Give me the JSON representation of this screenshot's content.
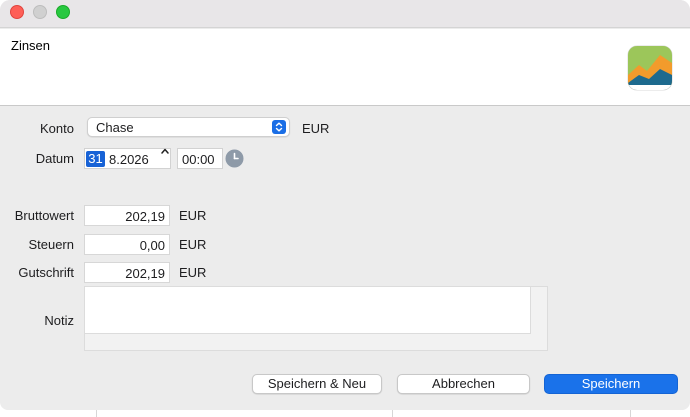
{
  "window": {
    "header_title": "Zinsen",
    "app_logo": "portfolio-chart-logo-icon"
  },
  "form": {
    "account_label": "Konto",
    "account_value": "Chase",
    "account_currency": "EUR",
    "date_label": "Datum",
    "date_day": "31",
    "date_rest": "8.2026",
    "time_value": "00:00",
    "gross_label": "Bruttowert",
    "gross_value": "202,19",
    "gross_currency": "EUR",
    "taxes_label": "Steuern",
    "taxes_value": "0,00",
    "taxes_currency": "EUR",
    "credit_label": "Gutschrift",
    "credit_value": "202,19",
    "credit_currency": "EUR",
    "note_label": "Notiz",
    "note_value": ""
  },
  "buttons": {
    "save_new": "Speichern & Neu",
    "cancel": "Abbrechen",
    "save": "Speichern"
  },
  "colors": {
    "accent": "#1a72ea",
    "close": "#fe5f57",
    "maximize": "#28c840"
  }
}
